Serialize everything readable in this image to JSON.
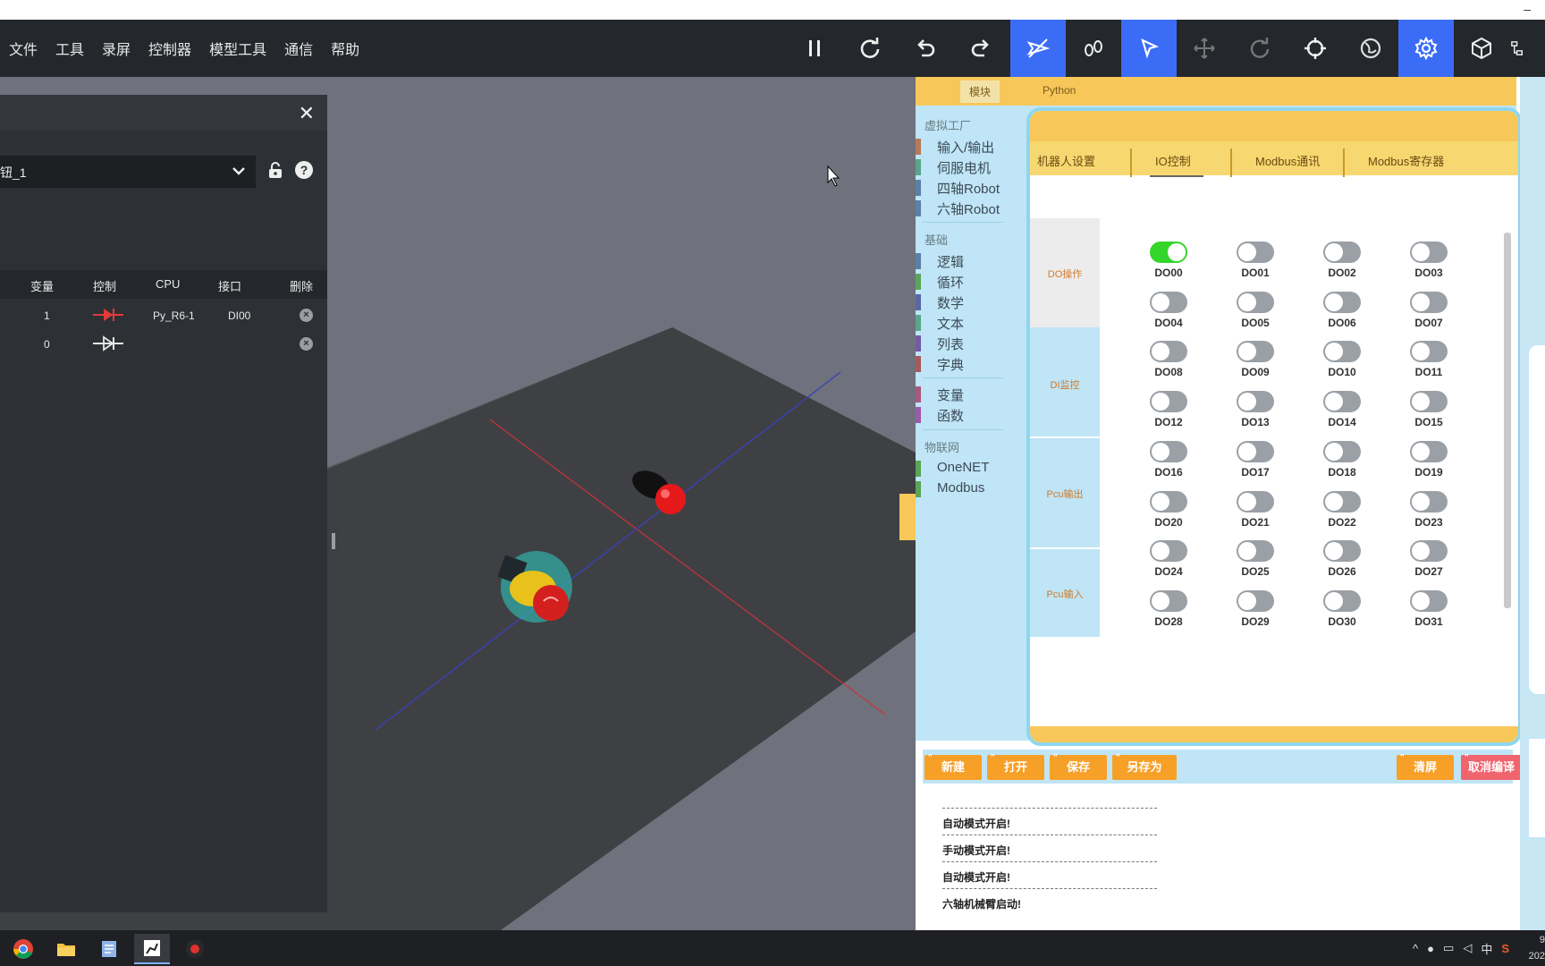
{
  "menu": [
    "文件",
    "工具",
    "录屏",
    "控制器",
    "模型工具",
    "通信",
    "帮助"
  ],
  "toolbar_icons": [
    "pause-icon",
    "redo-circle-icon",
    "undo-icon",
    "redo-icon",
    "plane-icon",
    "footprints-icon",
    "select-arrow-icon",
    "move-icon",
    "rotate-icon",
    "crosshair-icon",
    "globe-icon",
    "settings-gear-icon",
    "cube-icon",
    "hierarchy-icon"
  ],
  "accent": "#3b6cf6",
  "left_panel": {
    "close_glyph": "✕",
    "select_value": "钮_1",
    "help_glyph": "?",
    "columns": [
      "变量",
      "控制",
      "CPU",
      "接口",
      "删除"
    ],
    "rows": [
      {
        "var": "1",
        "cpu": "Py_R6-1",
        "port": "DI00",
        "active": true
      },
      {
        "var": "0",
        "cpu": "",
        "port": "",
        "active": false
      }
    ]
  },
  "right_panel": {
    "tabs": [
      "模块",
      "Python"
    ],
    "categories": {
      "group1": "虚拟工厂",
      "group1_items": [
        "输入/输出",
        "伺服电机",
        "四轴Robot",
        "六轴Robot"
      ],
      "group2": "基础",
      "group2_items": [
        "逻辑",
        "循环",
        "数学",
        "文本",
        "列表",
        "字典"
      ],
      "group3_items": [
        "变量",
        "函数"
      ],
      "group4": "物联网",
      "group4_items": [
        "OneNET",
        "Modbus"
      ]
    },
    "frame_tabs": [
      "机器人设置",
      "IO控制",
      "Modbus通讯",
      "Modbus寄存器"
    ],
    "side_tabs": [
      "DO操作",
      "DI监控",
      "Pcu输出",
      "Pcu输入"
    ],
    "do_labels": [
      "DO00",
      "DO01",
      "DO02",
      "DO03",
      "DO04",
      "DO05",
      "DO06",
      "DO07",
      "DO08",
      "DO09",
      "DO10",
      "DO11",
      "DO12",
      "DO13",
      "DO14",
      "DO15",
      "DO16",
      "DO17",
      "DO18",
      "DO19",
      "DO20",
      "DO21",
      "DO22",
      "DO23",
      "DO24",
      "DO25",
      "DO26",
      "DO27",
      "DO28",
      "DO29",
      "DO30",
      "DO31"
    ],
    "do_on": [
      "DO00"
    ],
    "actions": [
      "新建",
      "打开",
      "保存",
      "另存为",
      "清屏",
      "取消编译"
    ],
    "log": [
      "自动模式开启!",
      "手动模式开启!",
      "自动模式开启!",
      "六轴机械臂启动!"
    ]
  },
  "taskbar": {
    "apps": [
      "chrome-icon",
      "folder-icon",
      "notepad-icon",
      "robot-sim-icon",
      "recorder-icon"
    ],
    "tray_ime": "中",
    "clock_line1": "9",
    "clock_line2": "202"
  }
}
